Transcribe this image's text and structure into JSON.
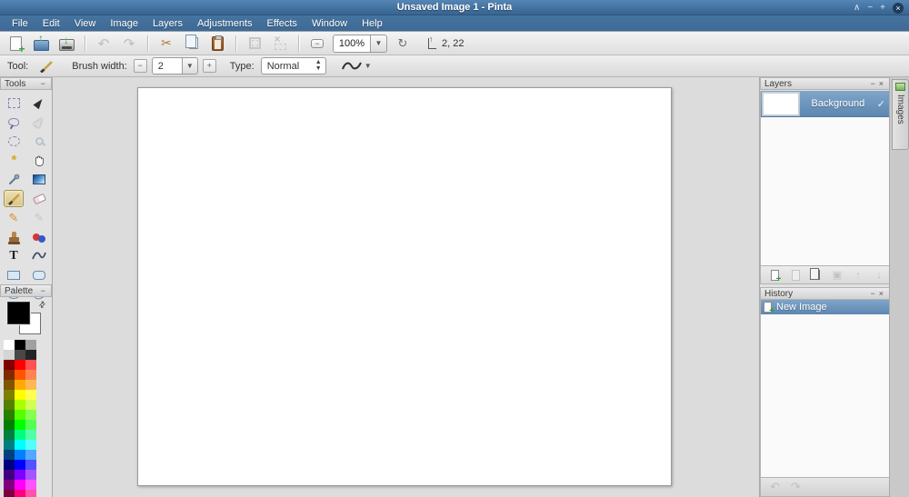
{
  "window": {
    "title": "Unsaved Image 1 - Pinta",
    "controls": {
      "shade": "∧",
      "minimize": "−",
      "maximize": "+",
      "close": "×"
    }
  },
  "menubar": {
    "items": [
      "File",
      "Edit",
      "View",
      "Image",
      "Layers",
      "Adjustments",
      "Effects",
      "Window",
      "Help"
    ]
  },
  "toolbar": {
    "icons": [
      "new-image-icon",
      "open-image-icon",
      "save-icon",
      "undo-icon",
      "redo-icon",
      "cut-icon",
      "copy-icon",
      "paste-icon",
      "crop-to-selection-icon",
      "deselect-icon",
      "zoom-out-icon",
      "best-fit-icon",
      "cursor-position-icon"
    ],
    "zoom_value": "100%",
    "cursor_position": "2, 22"
  },
  "tool_options": {
    "tool_label": "Tool:",
    "brush_width_label": "Brush width:",
    "brush_width_value": "2",
    "type_label": "Type:",
    "type_value": "Normal"
  },
  "tools_panel": {
    "title": "Tools",
    "active_tool": "paintbrush",
    "tools": [
      {
        "id": "rectangle-select",
        "glyph": "rect-dash"
      },
      {
        "id": "move-selected",
        "glyph": "arrow-dark"
      },
      {
        "id": "lasso-select",
        "glyph": "lasso"
      },
      {
        "id": "move-selection",
        "glyph": "arrow-light"
      },
      {
        "id": "ellipse-select",
        "glyph": "ellipse-dash"
      },
      {
        "id": "zoom",
        "glyph": "magnifier"
      },
      {
        "id": "magic-wand",
        "glyph": "wand"
      },
      {
        "id": "pan",
        "glyph": "hand"
      },
      {
        "id": "color-picker",
        "glyph": "dropper"
      },
      {
        "id": "gradient",
        "glyph": "gradient"
      },
      {
        "id": "paintbrush",
        "glyph": "brush",
        "active": true
      },
      {
        "id": "eraser",
        "glyph": "eraser"
      },
      {
        "id": "pencil",
        "glyph": "pencil"
      },
      {
        "id": "recolor",
        "glyph": "recolor"
      },
      {
        "id": "clone-stamp",
        "glyph": "stamp"
      },
      {
        "id": "color-replace",
        "glyph": "dots"
      },
      {
        "id": "text",
        "glyph": "text"
      },
      {
        "id": "line-curve",
        "glyph": "curve"
      },
      {
        "id": "rectangle",
        "glyph": "rect"
      },
      {
        "id": "rounded-rectangle",
        "glyph": "round-rect"
      },
      {
        "id": "ellipse",
        "glyph": "ellipse"
      },
      {
        "id": "freeform-shape",
        "glyph": "freeform"
      }
    ]
  },
  "palette_panel": {
    "title": "Palette",
    "primary_color": "#000000",
    "secondary_color": "#ffffff",
    "swatches": [
      "#ffffff",
      "#000000",
      "#a0a0a0",
      "#d4d4d4",
      "#484848",
      "#242424",
      "#7f0000",
      "#ff0000",
      "#ff5252",
      "#7f2a00",
      "#ff5500",
      "#ff8452",
      "#7f5500",
      "#ffaa00",
      "#ffb952",
      "#7f7f00",
      "#ffff00",
      "#ffff52",
      "#557f00",
      "#aaff00",
      "#d4ff52",
      "#2a7f00",
      "#55ff00",
      "#87ff52",
      "#007f00",
      "#00ff00",
      "#52ff52",
      "#007f40",
      "#00ff80",
      "#52ffa9",
      "#007f7f",
      "#00ffff",
      "#52ffff",
      "#00407f",
      "#0080ff",
      "#52a9ff",
      "#00007f",
      "#0000ff",
      "#5252ff",
      "#40007f",
      "#8000ff",
      "#a952ff",
      "#7f007f",
      "#ff00ff",
      "#ff52ff",
      "#7f0040",
      "#ff0080",
      "#ff52a9"
    ]
  },
  "layers_panel": {
    "title": "Layers",
    "layers": [
      {
        "name": "Background",
        "visible": true,
        "selected": true
      }
    ],
    "button_icons": [
      "add-layer-icon",
      "delete-layer-icon",
      "duplicate-layer-icon",
      "merge-layer-down-icon",
      "move-layer-up-icon",
      "move-layer-down-icon"
    ]
  },
  "history_panel": {
    "title": "History",
    "entries": [
      {
        "label": "New Image",
        "selected": true
      }
    ],
    "button_icons": [
      "history-undo-icon",
      "history-redo-icon"
    ]
  },
  "images_tab": {
    "label": "Images"
  },
  "colors": {
    "titlebar_blue": "#41719f",
    "selection_blue": "#6d94bb",
    "tool_highlight": "#dcc98f",
    "canvas_background": "#dcdcdc"
  }
}
